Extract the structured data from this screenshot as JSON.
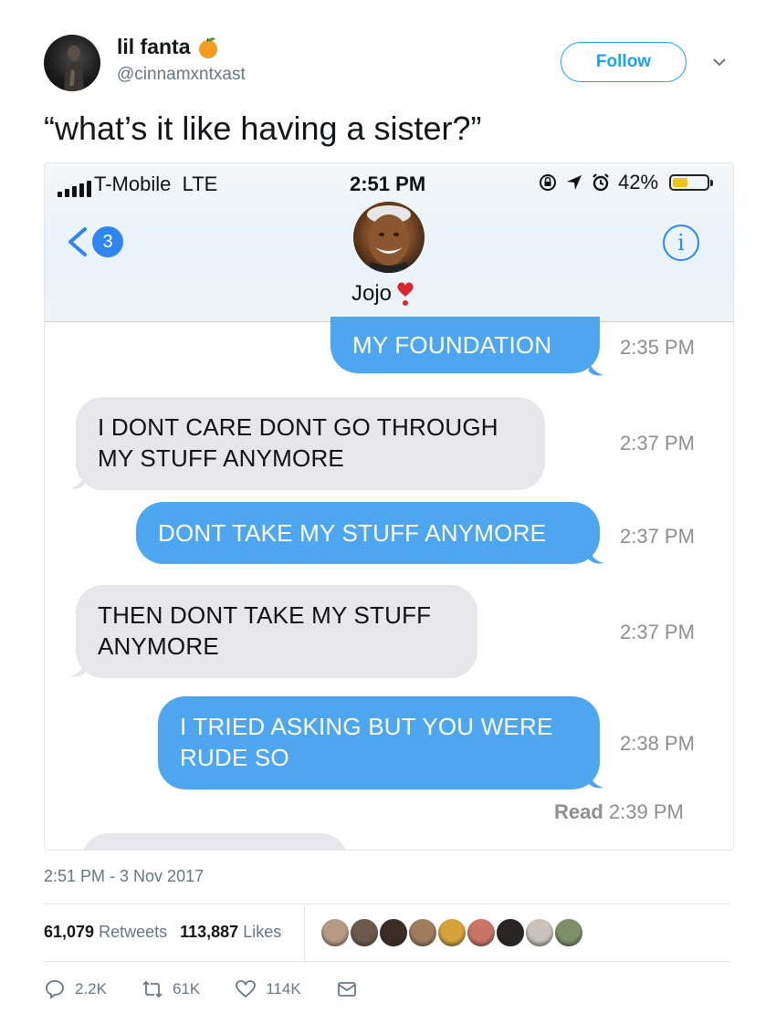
{
  "tweet": {
    "display_name": "lil fanta",
    "handle": "@cinnamxntxast",
    "follow_label": "Follow",
    "text": "“what’s it like having a sister?”",
    "date": "2:51 PM - 3 Nov 2017",
    "retweets_count": "61,079",
    "retweets_label": "Retweets",
    "likes_count": "113,887",
    "likes_label": "Likes",
    "actions": {
      "replies": "2.2K",
      "retweets": "61K",
      "likes": "114K"
    },
    "liker_colors": [
      "#b79a86",
      "#6b5a4c",
      "#3b2c24",
      "#a07c5e",
      "#d4a23a",
      "#c87566",
      "#2a2424",
      "#c9c2bc",
      "#7f8e6a"
    ]
  },
  "screenshot": {
    "status": {
      "carrier": "T-Mobile",
      "network": "LTE",
      "time": "2:51 PM",
      "battery": "42%"
    },
    "back_count": "3",
    "contact_name": "Jojo",
    "info_label": "i",
    "messages": [
      {
        "text": "MY FOUNDATION",
        "time": "2:35 PM"
      },
      {
        "text1": "I DONT CARE DONT GO THROUGH",
        "text2": "MY STUFF ANYMORE",
        "time": "2:37 PM"
      },
      {
        "text": "DONT TAKE MY STUFF ANYMORE",
        "time": "2:37 PM"
      },
      {
        "text1": "THEN DONT TAKE MY STUFF",
        "text2": "ANYMORE",
        "time": "2:37 PM"
      },
      {
        "text1": "I TRIED ASKING BUT YOU WERE",
        "text2": "RUDE SO",
        "time": "2:38 PM"
      }
    ],
    "read_label": "Read",
    "read_time": "2:39 PM"
  },
  "colors": {
    "twitter_blue": "#1da1f2",
    "imessage_blue": "#4ea6f1",
    "grey_bubble": "#e6e6eb"
  }
}
